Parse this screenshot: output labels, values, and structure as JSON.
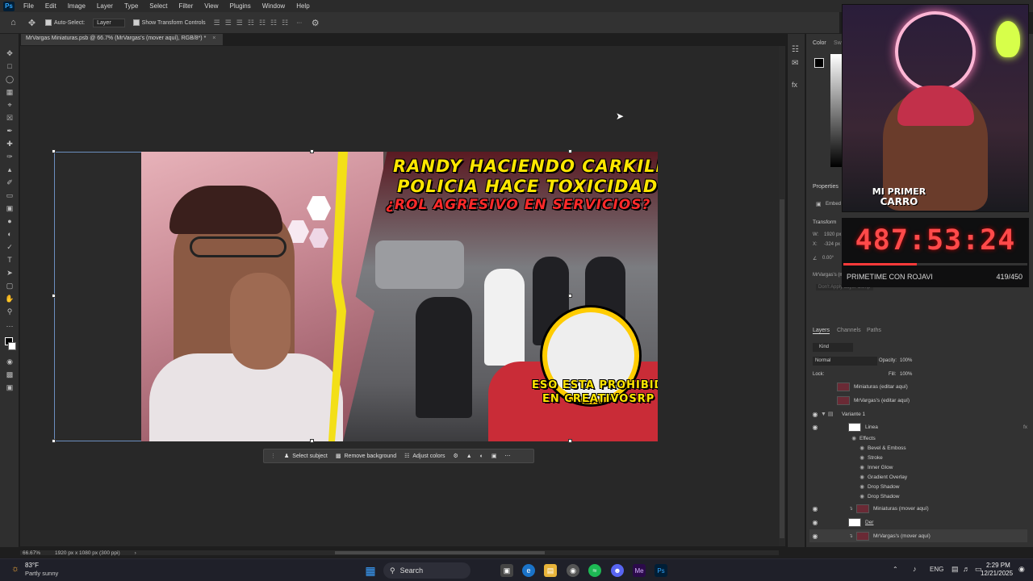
{
  "menubar": {
    "logo": "Ps",
    "items": [
      "File",
      "Edit",
      "Image",
      "Layer",
      "Type",
      "Select",
      "Filter",
      "View",
      "Plugins",
      "Window",
      "Help"
    ]
  },
  "optionsbar": {
    "auto_select_label": "Auto-Select:",
    "auto_select_value": "Layer",
    "transform_controls_label": "Show Transform Controls",
    "more_label": "···"
  },
  "document": {
    "tab_title": "MrVargas Miniaturas.psb @ 66.7% (MrVargas's (mover aquí), RGB/8*) *",
    "close_glyph": "×"
  },
  "thumbnail": {
    "line1": "RANDY HACIENDO CARKILL",
    "line2": "POLICIA HACE TOXICIDAD",
    "line3": "¿ROL AGRESIVO EN SERVICIOS?",
    "badge_line1": "ESO ESTA PROHIBIDO",
    "badge_line2": "EN CREATIVOSRP",
    "colors": {
      "yellow": "#ffe600",
      "red": "#ff2a2a"
    }
  },
  "contextbar": {
    "select_subject": "Select subject",
    "remove_background": "Remove background",
    "adjust_colors": "Adjust colors"
  },
  "statusbar": {
    "zoom": "66.67%",
    "doc_size": "1920 px x 1080 px (300 ppi)"
  },
  "rightpanel": {
    "color_tab": "Color",
    "swatches_tab": "Swa",
    "properties_tab": "Properties",
    "embed_label": "Embed",
    "transform_label": "Transform",
    "w_label": "W:",
    "w_value": "1920 px",
    "x_label": "X:",
    "x_value": "-324 px",
    "angle_value": "0.00°",
    "linked_label": "MrVargas's (mover",
    "dont_apply": "Don't Apply Layer Comp",
    "layers_tab": "Layers",
    "channels_tab": "Channels",
    "paths_tab": "Paths",
    "kind_label": "Kind",
    "blend_mode": "Normal",
    "opacity_label": "Opacity:",
    "opacity_value": "100%",
    "lock_label": "Lock:",
    "fill_label": "Fill:",
    "fill_value": "100%",
    "layers": [
      {
        "name": "Miniaturas (editar aquí)",
        "visible": false
      },
      {
        "name": "MrVargas's (editar aquí)",
        "visible": false
      },
      {
        "name": "Variante 1",
        "visible": true
      },
      {
        "name": "Linea",
        "visible": true
      },
      {
        "name": "Effects",
        "visible": false
      },
      {
        "name": "Bevel & Emboss",
        "visible": true
      },
      {
        "name": "Stroke",
        "visible": true
      },
      {
        "name": "Inner Glow",
        "visible": true
      },
      {
        "name": "Gradient Overlay",
        "visible": true
      },
      {
        "name": "Drop Shadow",
        "visible": true
      },
      {
        "name": "Drop Shadow",
        "visible": true
      },
      {
        "name": "Miniaturas (mover aquí)",
        "visible": true
      },
      {
        "name": "Der",
        "visible": true
      },
      {
        "name": "MrVargas's (mover aquí)",
        "visible": true
      }
    ]
  },
  "stream_overlay": {
    "sign_line1": "MI PRIMER",
    "sign_line2": "CARRO",
    "timer": "487:53:24",
    "caption": "PRIMETIME CON ROJAVI",
    "count": "419/450",
    "progress": 0.4
  },
  "taskbar": {
    "weather_temp": "83°F",
    "weather_desc": "Partly sunny",
    "search_label": "Search",
    "lang": "ENG",
    "time": "2:29 PM",
    "date": "12/21/2025"
  }
}
